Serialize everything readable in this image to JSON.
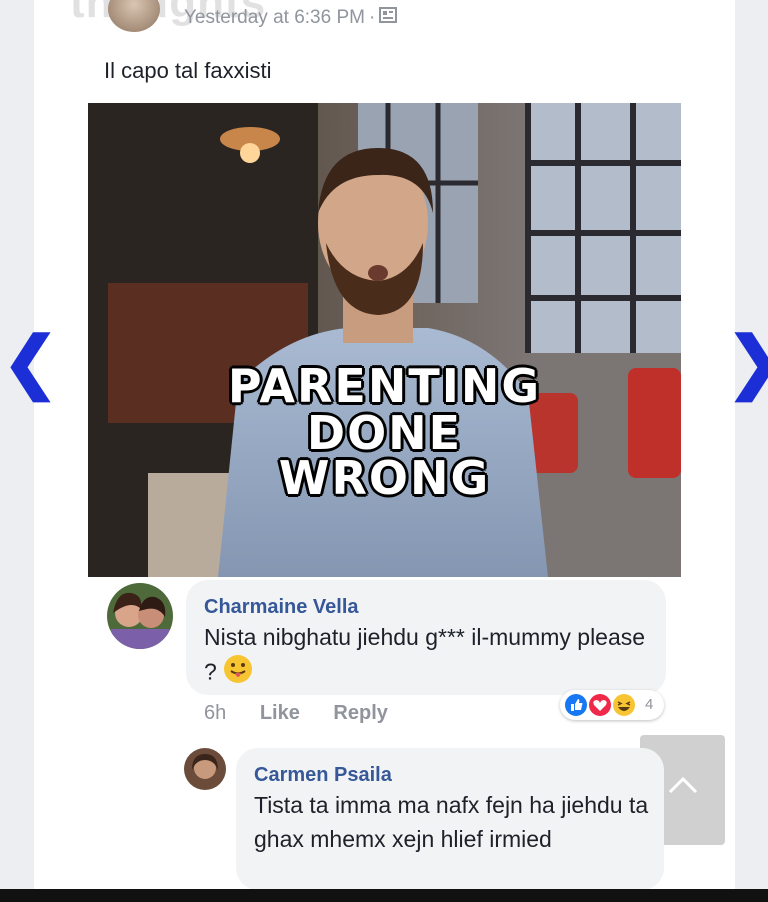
{
  "post": {
    "watermark": "thoughts",
    "timestamp": "Yesterday at 6:36 PM",
    "separator": "·",
    "privacy_icon": "photo-frame-icon",
    "text": "Il capo tal faxxisti",
    "meme_lines": [
      "PARENTING",
      "DONE",
      "WRONG"
    ]
  },
  "nav": {
    "prev": "❮",
    "next": "❯"
  },
  "comments": [
    {
      "name": "Charmaine Vella",
      "text": "Nista nibghatu jiehdu g*** il-mummy please ?",
      "emoji": "tongue-out-emoji",
      "time": "6h",
      "like": "Like",
      "reply": "Reply",
      "reaction_icons": [
        "like-reaction-icon",
        "love-reaction-icon",
        "haha-reaction-icon"
      ],
      "reaction_count": "4"
    },
    {
      "name": "Carmen Psaila",
      "text": "Tista ta imma ma nafx fejn ha jiehdu ta ghax mhemx xejn hlief irmied"
    }
  ],
  "colors": {
    "nav_arrow": "#1c2fd6",
    "name": "#365899",
    "bubble": "#f2f3f5"
  }
}
